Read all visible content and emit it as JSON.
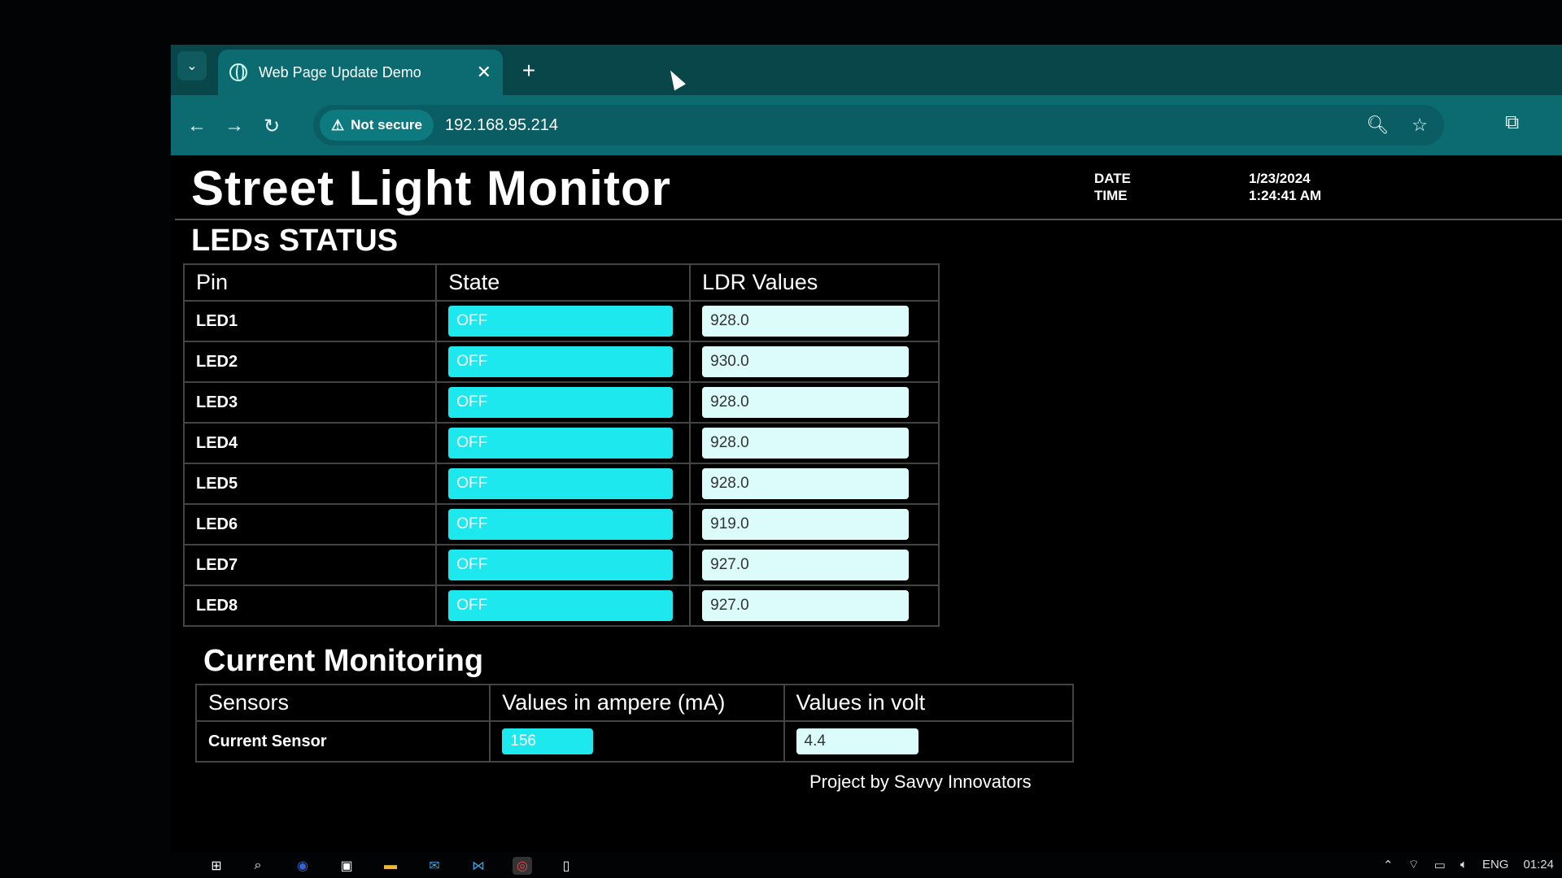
{
  "browser": {
    "tab_title": "Web Page Update Demo",
    "security_label": "Not secure",
    "url": "192.168.95.214"
  },
  "page": {
    "title": "Street Light Monitor",
    "date_label": "DATE",
    "time_label": "TIME",
    "date_value": "1/23/2024",
    "time_value": "1:24:41 AM",
    "leds_heading": "LEDs STATUS",
    "led_table": {
      "headers": [
        "Pin",
        "State",
        "LDR Values"
      ],
      "rows": [
        {
          "pin": "LED1",
          "state": "OFF",
          "ldr": "928.0"
        },
        {
          "pin": "LED2",
          "state": "OFF",
          "ldr": "930.0"
        },
        {
          "pin": "LED3",
          "state": "OFF",
          "ldr": "928.0"
        },
        {
          "pin": "LED4",
          "state": "OFF",
          "ldr": "928.0"
        },
        {
          "pin": "LED5",
          "state": "OFF",
          "ldr": "928.0"
        },
        {
          "pin": "LED6",
          "state": "OFF",
          "ldr": "919.0"
        },
        {
          "pin": "LED7",
          "state": "OFF",
          "ldr": "927.0"
        },
        {
          "pin": "LED8",
          "state": "OFF",
          "ldr": "927.0"
        }
      ]
    },
    "current_heading": "Current Monitoring",
    "current_table": {
      "headers": [
        "Sensors",
        "Values in ampere (mA)",
        "Values in volt"
      ],
      "rows": [
        {
          "sensor": "Current Sensor",
          "ampere": "156",
          "volt": "4.4"
        }
      ]
    },
    "footer": "Project by Savvy Innovators"
  },
  "taskbar": {
    "language": "ENG",
    "clock": "01:24"
  },
  "colors": {
    "state_box": "#1ce8ee",
    "ldr_box": "#dcfcfc",
    "toolbar": "#0b6b70"
  }
}
